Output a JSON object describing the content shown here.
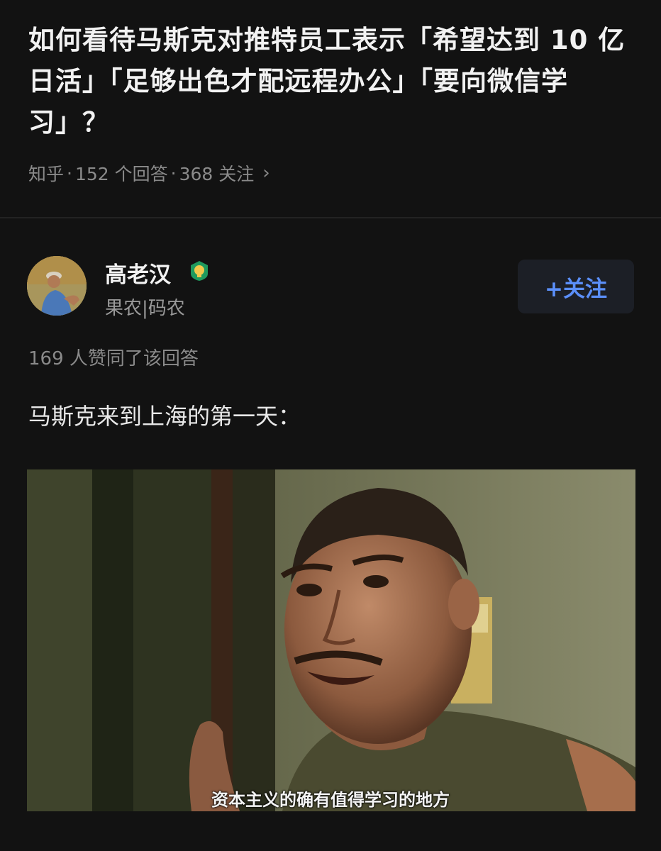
{
  "question": {
    "title": "如何看待马斯克对推特员工表示「希望达到 10 亿日活」「足够出色才配远程办公」「要向微信学习」？",
    "source": "知乎",
    "answers": "152 个回答",
    "followers": "368 关注",
    "chevron": "›"
  },
  "answer": {
    "author_name": "高老汉",
    "author_bio": "果农|码农",
    "follow_label": "+关注",
    "upvotes": "169 人赞同了该回答",
    "text": "马斯克来到上海的第一天：",
    "video_subtitle": "资本主义的确有值得学习的地方",
    "badge_icon": "verified-badge-icon",
    "accent_color": "#5b8ff9"
  }
}
